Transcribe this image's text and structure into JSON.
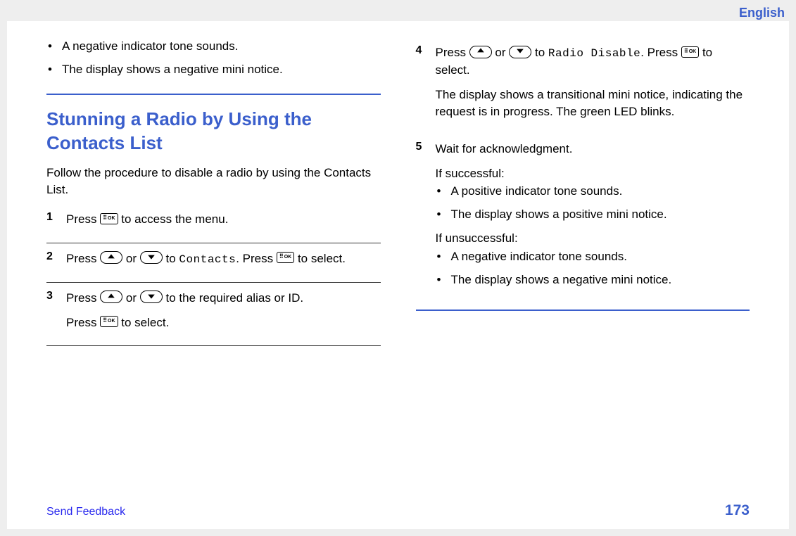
{
  "header": {
    "language": "English"
  },
  "left": {
    "top_bullets": [
      "A negative indicator tone sounds.",
      "The display shows a negative mini notice."
    ],
    "heading": "Stunning a Radio by Using the Contacts List",
    "intro": "Follow the procedure to disable a radio by using the Contacts List.",
    "step1": {
      "num": "1",
      "a": "Press ",
      "b": " to access the menu."
    },
    "step2": {
      "num": "2",
      "a": "Press ",
      "b": " or ",
      "c": " to ",
      "mono": "Contacts",
      "d": ". Press ",
      "e": " to select."
    },
    "step3": {
      "num": "3",
      "a": "Press ",
      "b": " or ",
      "c": " to the required alias or ID.",
      "line2a": "Press ",
      "line2b": " to select."
    }
  },
  "right": {
    "step4": {
      "num": "4",
      "a": "Press ",
      "b": " or ",
      "c": " to ",
      "mono": "Radio Disable",
      "d": ". Press ",
      "e": " to select.",
      "para2": "The display shows a transitional mini notice, indicating the request is in progress. The green LED blinks."
    },
    "step5": {
      "num": "5",
      "line1": "Wait for acknowledgment.",
      "if_success": "If successful:",
      "success_bullets": [
        "A positive indicator tone sounds.",
        "The display shows a positive mini notice."
      ],
      "if_unsuccess": "If unsuccessful:",
      "unsuccess_bullets": [
        "A negative indicator tone sounds.",
        "The display shows a negative mini notice."
      ]
    }
  },
  "footer": {
    "feedback": "Send Feedback",
    "page": "173"
  },
  "labels": {
    "ok": "OK"
  }
}
